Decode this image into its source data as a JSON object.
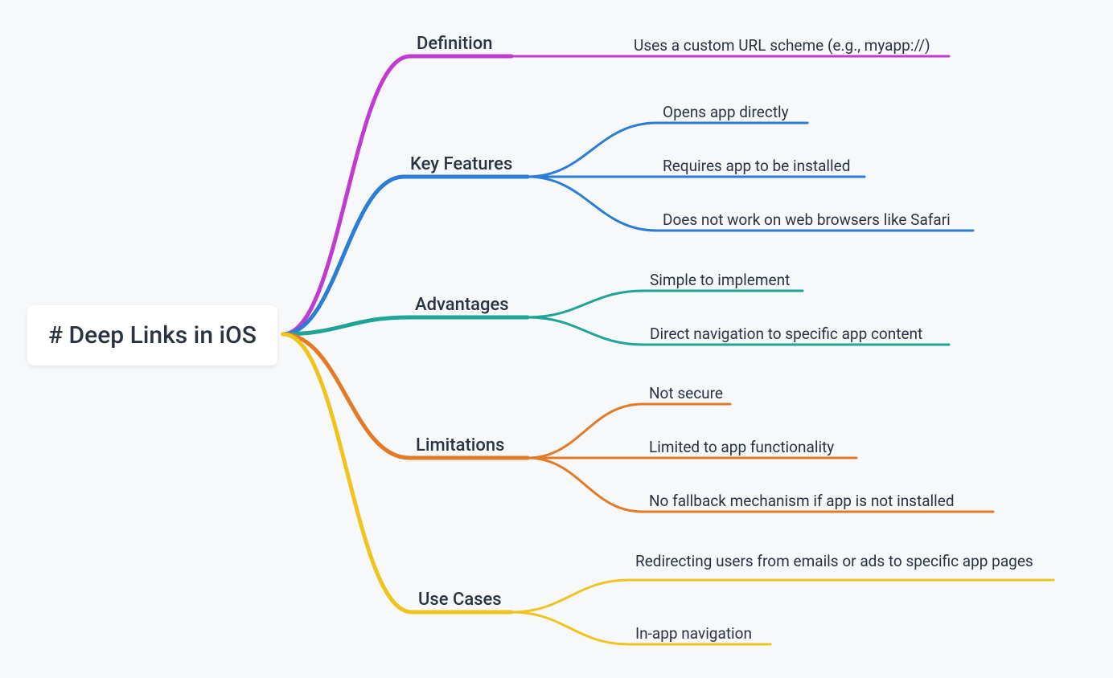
{
  "root": {
    "label": "# Deep Links in iOS"
  },
  "colors": {
    "purple": "#c13bd1",
    "blue": "#2b7ed3",
    "teal": "#1fa597",
    "orange": "#e27a26",
    "yellow": "#efc41f"
  },
  "branches": [
    {
      "id": "definition",
      "label": "Definition",
      "colorKey": "purple",
      "children": [
        {
          "label": "Uses a custom URL scheme (e.g., myapp://)"
        }
      ]
    },
    {
      "id": "keyfeatures",
      "label": "Key Features",
      "colorKey": "blue",
      "children": [
        {
          "label": "Opens app directly"
        },
        {
          "label": "Requires app to be installed"
        },
        {
          "label": "Does not work on web browsers like Safari"
        }
      ]
    },
    {
      "id": "advantages",
      "label": "Advantages",
      "colorKey": "teal",
      "children": [
        {
          "label": "Simple to implement"
        },
        {
          "label": "Direct navigation to specific app content"
        }
      ]
    },
    {
      "id": "limitations",
      "label": "Limitations",
      "colorKey": "orange",
      "children": [
        {
          "label": "Not secure"
        },
        {
          "label": "Limited to app functionality"
        },
        {
          "label": "No fallback mechanism if app is not installed"
        }
      ]
    },
    {
      "id": "usecases",
      "label": "Use Cases",
      "colorKey": "yellow",
      "children": [
        {
          "label": "Redirecting users from emails or ads to specific app pages"
        },
        {
          "label": "In-app navigation"
        }
      ]
    }
  ]
}
